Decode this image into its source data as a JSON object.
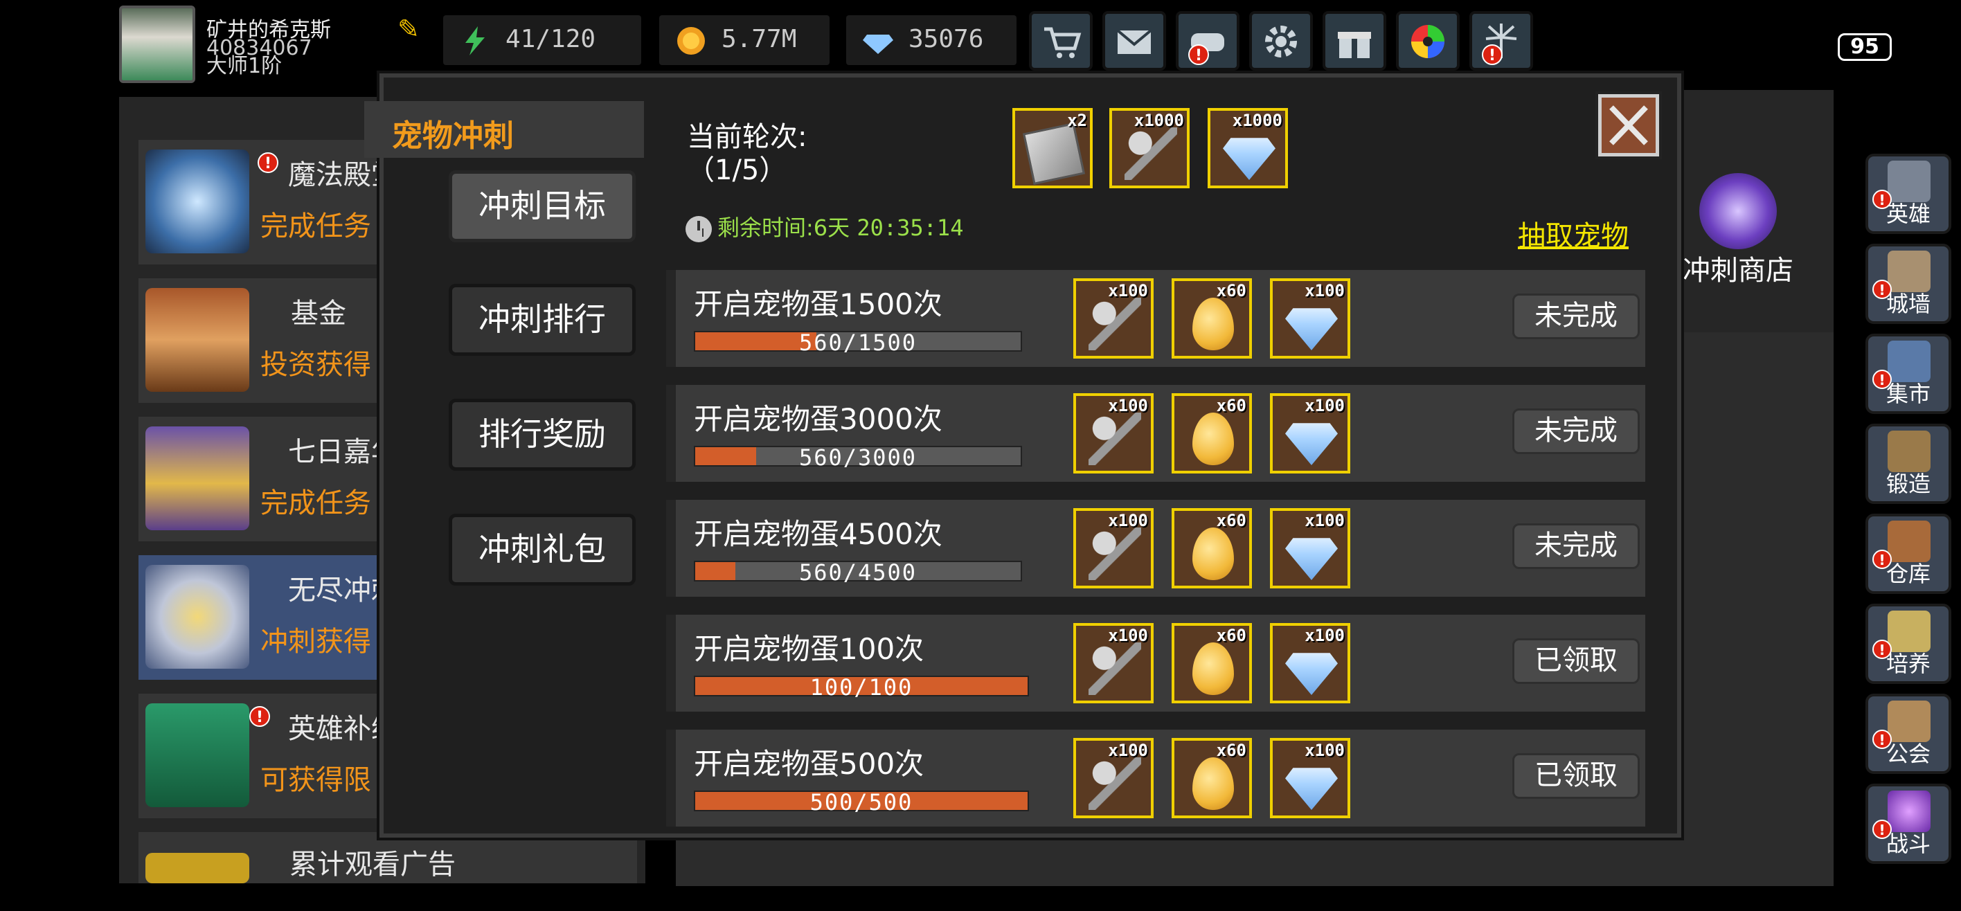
{
  "player": {
    "name": "矿井的希克斯",
    "id": "40834067",
    "rank": "大师1阶"
  },
  "resources": [
    {
      "icon": "energy-icon",
      "value": "41/120"
    },
    {
      "icon": "gold-coin-icon",
      "value": "5.77M"
    },
    {
      "icon": "gem-icon",
      "value": "35076"
    }
  ],
  "toolbar": [
    "cart-icon",
    "mail-icon",
    "gamepad-icon",
    "settings-icon",
    "gift-icon",
    "color-wheel-icon",
    "firework-icon"
  ],
  "battery": "95",
  "left_list": [
    {
      "title": "魔法殿堂",
      "sub": "完成任务"
    },
    {
      "title": "基金",
      "sub": "投资获得"
    },
    {
      "title": "七日嘉年",
      "sub": "完成任务"
    },
    {
      "title": "无尽冲刺",
      "sub": "冲刺获得"
    },
    {
      "title": "英雄补给",
      "sub": "可获得限"
    },
    {
      "title": "累计观看广告",
      "sub": ""
    }
  ],
  "right_nav": [
    "英雄",
    "城墙",
    "集市",
    "锻造",
    "仓库",
    "培养",
    "公会",
    "战斗"
  ],
  "shop_label": "冲刺商店",
  "modal": {
    "tab_title": "宠物冲刺",
    "side_buttons": [
      "冲刺目标",
      "冲刺排行",
      "排行奖励",
      "冲刺礼包"
    ],
    "round_label": "当前轮次:\n（1/5）",
    "round_rewards": [
      {
        "qty": "x2",
        "icon": "scroll-icon"
      },
      {
        "qty": "x1000",
        "icon": "hammer-icon"
      },
      {
        "qty": "x1000",
        "icon": "diamond-icon"
      }
    ],
    "timer_label": "剩余时间:6天",
    "timer_value": "20:35:14",
    "draw_link": "抽取宠物",
    "tasks": [
      {
        "title": "开启宠物蛋1500次",
        "progress": "560/1500",
        "current": 560,
        "target": 1500,
        "status": "未完成"
      },
      {
        "title": "开启宠物蛋3000次",
        "progress": "560/3000",
        "current": 560,
        "target": 3000,
        "status": "未完成"
      },
      {
        "title": "开启宠物蛋4500次",
        "progress": "560/4500",
        "current": 560,
        "target": 4500,
        "status": "未完成"
      },
      {
        "title": "开启宠物蛋100次",
        "progress": "100/100",
        "current": 100,
        "target": 100,
        "status": "已领取"
      },
      {
        "title": "开启宠物蛋500次",
        "progress": "500/500",
        "current": 500,
        "target": 500,
        "status": "已领取"
      }
    ],
    "task_rewards": [
      {
        "qty": "x100",
        "icon": "hammer-icon"
      },
      {
        "qty": "x60",
        "icon": "pet-egg-icon"
      },
      {
        "qty": "x100",
        "icon": "diamond-icon"
      }
    ]
  }
}
